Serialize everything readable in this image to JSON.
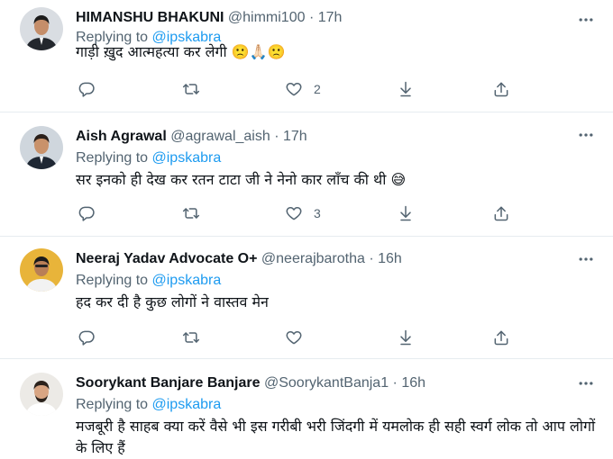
{
  "tweets": [
    {
      "name": "HIMANSHU BHAKUNI",
      "handle": "@himmi100",
      "separator": "·",
      "time": "17h",
      "replying_prefix": "Replying to",
      "replying_to": "@ipskabra",
      "text": "गाड़ी ख़ुद आत्महत्या कर लेगी 🙁🙏🏻🙁",
      "likes": "2",
      "avatar": {
        "bg": "#d9dde2",
        "skin": "#c58e6a",
        "hair": "#1c1c1c",
        "shirt": "#23272d"
      }
    },
    {
      "name": "Aish Agrawal",
      "handle": "@agrawal_aish",
      "separator": "·",
      "time": "17h",
      "replying_prefix": "Replying to",
      "replying_to": "@ipskabra",
      "text": "सर इनको ही देख कर रतन टाटा जी ने नेनो कार लॉंच की थी 😅",
      "likes": "3",
      "avatar": {
        "bg": "#cfd6dd",
        "skin": "#c9926b",
        "hair": "#2a1f1a",
        "shirt": "#1e2733"
      }
    },
    {
      "name": "Neeraj Yadav Advocate O+",
      "handle": "@neerajbarotha",
      "separator": "·",
      "time": "16h",
      "replying_prefix": "Replying to",
      "replying_to": "@ipskabra",
      "text": "हद कर दी है कुछ लोगों ने वास्तव मेन",
      "likes": "",
      "avatar": {
        "bg": "#e8b43a",
        "skin": "#b97f57",
        "hair": "#1a1a1a",
        "shirt": "#f2f2f2"
      }
    },
    {
      "name": "Soorykant Banjare Banjare",
      "handle": "@SoorykantBanja1",
      "separator": "·",
      "time": "16h",
      "replying_prefix": "Replying to",
      "replying_to": "@ipskabra",
      "text": "मजबूरी है साहब क्या करें वैसे भी इस गरीबी भरी जिंदगी में यमलोक ही सही स्वर्ग लोक तो आप लोगों के लिए हैं",
      "likes": "",
      "avatar": {
        "bg": "#eceae6",
        "skin": "#d8a583",
        "hair": "#2b221c",
        "shirt": "#ffffff"
      }
    }
  ],
  "icons": {
    "more": "more-icon",
    "reply": "reply-icon",
    "retweet": "retweet-icon",
    "like": "like-icon",
    "download": "download-icon",
    "share": "share-icon"
  },
  "colors": {
    "mention": "#1d9bf0",
    "secondary_text": "#536471",
    "divider": "#e6ecf0"
  }
}
